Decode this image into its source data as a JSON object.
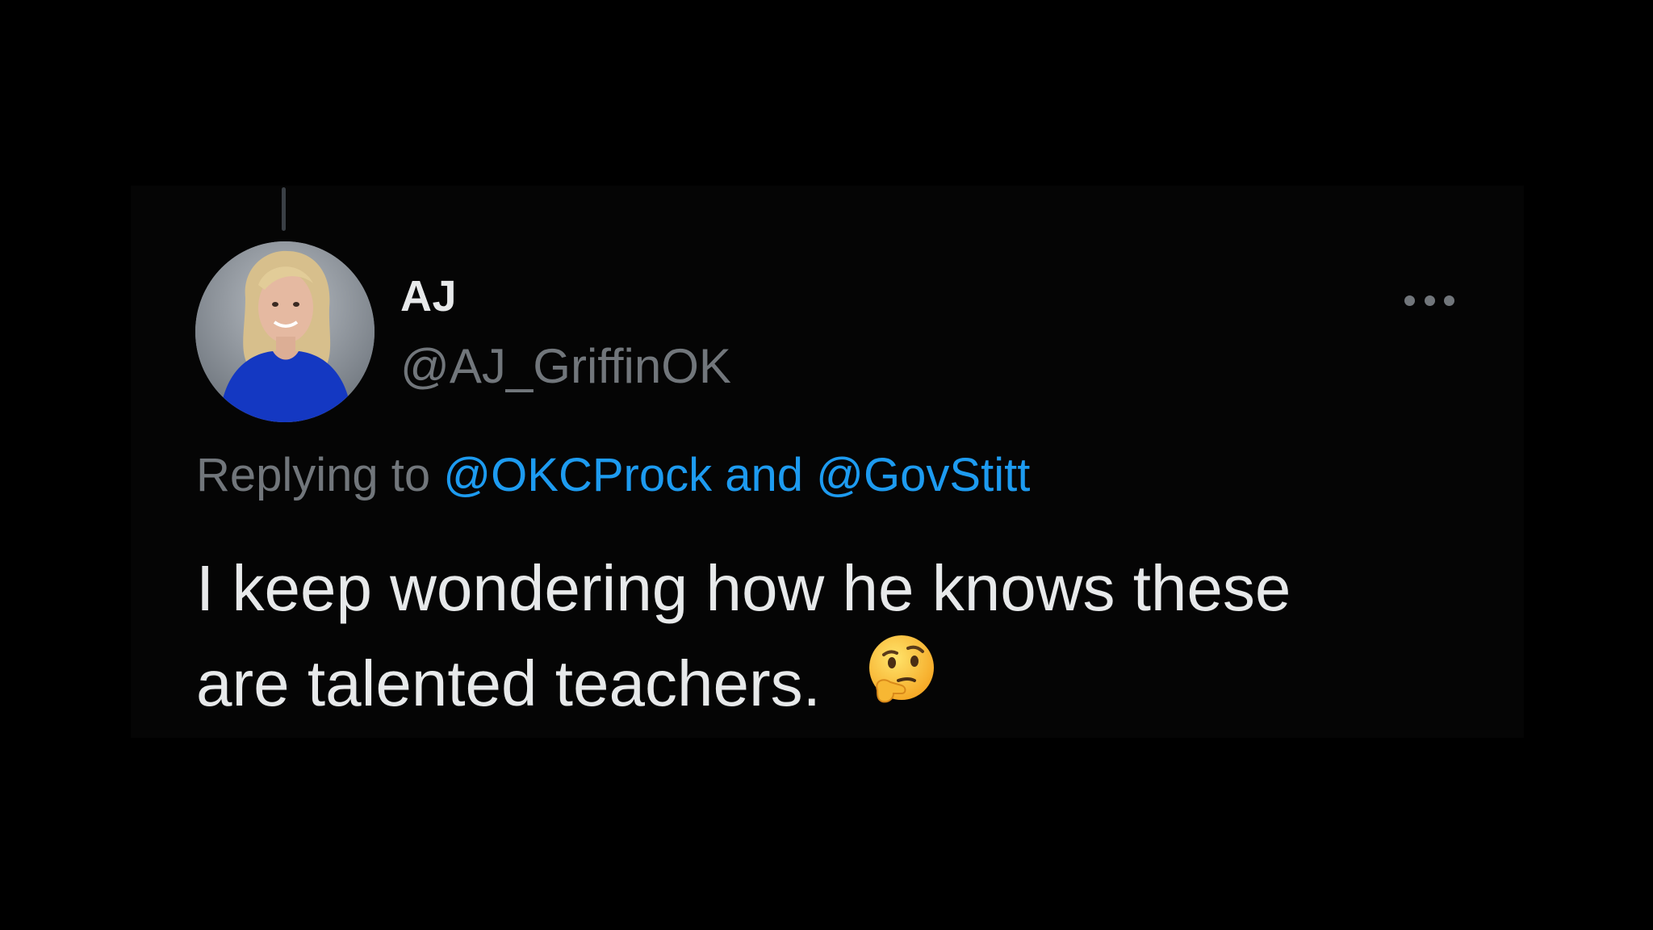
{
  "tweet": {
    "author": {
      "display_name": "AJ",
      "handle": "@AJ_GriffinOK",
      "avatar_icon": "profile-photo"
    },
    "replying": {
      "prefix": "Replying to",
      "mention_1": "@OKCProck",
      "joiner": "and",
      "mention_2": "@GovStitt"
    },
    "text_line_1": "I keep wondering how he knows these",
    "text_line_2": "are talented teachers.",
    "emoji_icon": "thinking-face-emoji",
    "more_icon": "more-options-icon"
  },
  "colors": {
    "background": "#000000",
    "primary_text": "#e7e9ea",
    "secondary_text": "#71767b",
    "link": "#1d9bf0"
  }
}
